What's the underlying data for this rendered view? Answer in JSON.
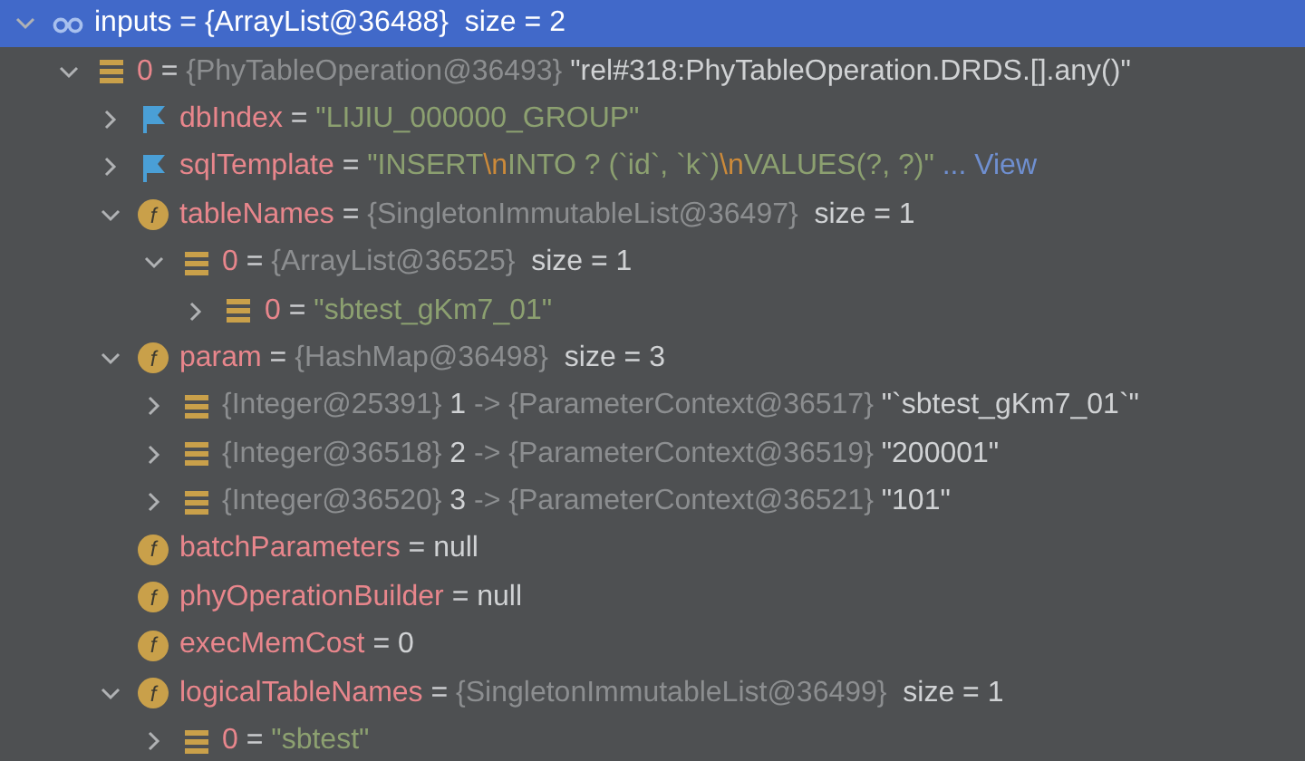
{
  "tree": [
    {
      "kind": "watch",
      "selected": true,
      "expanded": true,
      "name": "inputs",
      "parts": [
        {
          "kind": "plain",
          "text": " = "
        },
        {
          "kind": "text",
          "text": "{ArrayList@36488}"
        },
        {
          "kind": "text",
          "text": "  size = 2"
        }
      ],
      "children": [
        {
          "kind": "element",
          "selected": false,
          "expanded": true,
          "name": "0",
          "parts": [
            {
              "kind": "plain",
              "text": " = "
            },
            {
              "kind": "type",
              "text": "{PhyTableOperation@36493}"
            },
            {
              "kind": "text",
              "text": " \"rel#318:PhyTableOperation.DRDS.[].any()\""
            }
          ],
          "children": [
            {
              "kind": "flag",
              "selected": false,
              "expanded": false,
              "name": "dbIndex",
              "parts": [
                {
                  "kind": "plain",
                  "text": " = "
                },
                {
                  "kind": "string",
                  "text": "\"LIJIU_000000_GROUP\""
                }
              ]
            },
            {
              "kind": "flag",
              "selected": false,
              "expanded": false,
              "name": "sqlTemplate",
              "parts": [
                {
                  "kind": "plain",
                  "text": " = "
                },
                {
                  "kind": "string",
                  "text": "\"INSERT"
                },
                {
                  "kind": "escape",
                  "text": "\\n"
                },
                {
                  "kind": "string",
                  "text": "INTO ? (`id`, `k`)"
                },
                {
                  "kind": "escape",
                  "text": "\\n"
                },
                {
                  "kind": "string",
                  "text": "VALUES(?, ?)\""
                },
                {
                  "kind": "link",
                  "text": " ... View"
                }
              ]
            },
            {
              "kind": "field",
              "icon": "f",
              "selected": false,
              "expanded": true,
              "name": "tableNames",
              "parts": [
                {
                  "kind": "plain",
                  "text": " = "
                },
                {
                  "kind": "type",
                  "text": "{SingletonImmutableList@36497}"
                },
                {
                  "kind": "text",
                  "text": "  size = 1"
                }
              ],
              "children": [
                {
                  "kind": "element",
                  "selected": false,
                  "expanded": true,
                  "name": "0",
                  "parts": [
                    {
                      "kind": "plain",
                      "text": " = "
                    },
                    {
                      "kind": "type",
                      "text": "{ArrayList@36525}"
                    },
                    {
                      "kind": "text",
                      "text": "  size = 1"
                    }
                  ],
                  "children": [
                    {
                      "kind": "element",
                      "selected": false,
                      "expanded": false,
                      "name": "0",
                      "parts": [
                        {
                          "kind": "plain",
                          "text": " = "
                        },
                        {
                          "kind": "string",
                          "text": "\"sbtest_gKm7_01\""
                        }
                      ]
                    }
                  ]
                }
              ]
            },
            {
              "kind": "field",
              "icon": "f",
              "selected": false,
              "expanded": true,
              "name": "param",
              "parts": [
                {
                  "kind": "plain",
                  "text": " = "
                },
                {
                  "kind": "type",
                  "text": "{HashMap@36498}"
                },
                {
                  "kind": "text",
                  "text": "  size = 3"
                }
              ],
              "children": [
                {
                  "kind": "element",
                  "selected": false,
                  "expanded": false,
                  "parts": [
                    {
                      "kind": "type",
                      "text": "{Integer@25391}"
                    },
                    {
                      "kind": "text",
                      "text": " 1 "
                    },
                    {
                      "kind": "type",
                      "text": "-> {ParameterContext@36517}"
                    },
                    {
                      "kind": "text",
                      "text": " \"`sbtest_gKm7_01`\""
                    }
                  ]
                },
                {
                  "kind": "element",
                  "selected": false,
                  "expanded": false,
                  "parts": [
                    {
                      "kind": "type",
                      "text": "{Integer@36518}"
                    },
                    {
                      "kind": "text",
                      "text": " 2 "
                    },
                    {
                      "kind": "type",
                      "text": "-> {ParameterContext@36519}"
                    },
                    {
                      "kind": "text",
                      "text": " \"200001\""
                    }
                  ]
                },
                {
                  "kind": "element",
                  "selected": false,
                  "expanded": false,
                  "parts": [
                    {
                      "kind": "type",
                      "text": "{Integer@36520}"
                    },
                    {
                      "kind": "text",
                      "text": " 3 "
                    },
                    {
                      "kind": "type",
                      "text": "-> {ParameterContext@36521}"
                    },
                    {
                      "kind": "text",
                      "text": " \"101\""
                    }
                  ]
                }
              ]
            },
            {
              "kind": "field",
              "icon": "f",
              "selected": false,
              "name": "batchParameters",
              "parts": [
                {
                  "kind": "plain",
                  "text": " = "
                },
                {
                  "kind": "text",
                  "text": "null"
                }
              ]
            },
            {
              "kind": "field",
              "icon": "f",
              "selected": false,
              "name": "phyOperationBuilder",
              "parts": [
                {
                  "kind": "plain",
                  "text": " = "
                },
                {
                  "kind": "text",
                  "text": "null"
                }
              ]
            },
            {
              "kind": "field",
              "icon": "f",
              "selected": false,
              "name": "execMemCost",
              "parts": [
                {
                  "kind": "plain",
                  "text": " = "
                },
                {
                  "kind": "text",
                  "text": "0"
                }
              ]
            },
            {
              "kind": "field",
              "icon": "f",
              "selected": false,
              "expanded": true,
              "name": "logicalTableNames",
              "parts": [
                {
                  "kind": "plain",
                  "text": " = "
                },
                {
                  "kind": "type",
                  "text": "{SingletonImmutableList@36499}"
                },
                {
                  "kind": "text",
                  "text": "  size = 1"
                }
              ],
              "children": [
                {
                  "kind": "element",
                  "selected": false,
                  "expanded": false,
                  "name": "0",
                  "parts": [
                    {
                      "kind": "plain",
                      "text": " = "
                    },
                    {
                      "kind": "string",
                      "text": "\"sbtest\""
                    }
                  ]
                }
              ]
            }
          ]
        }
      ]
    }
  ]
}
